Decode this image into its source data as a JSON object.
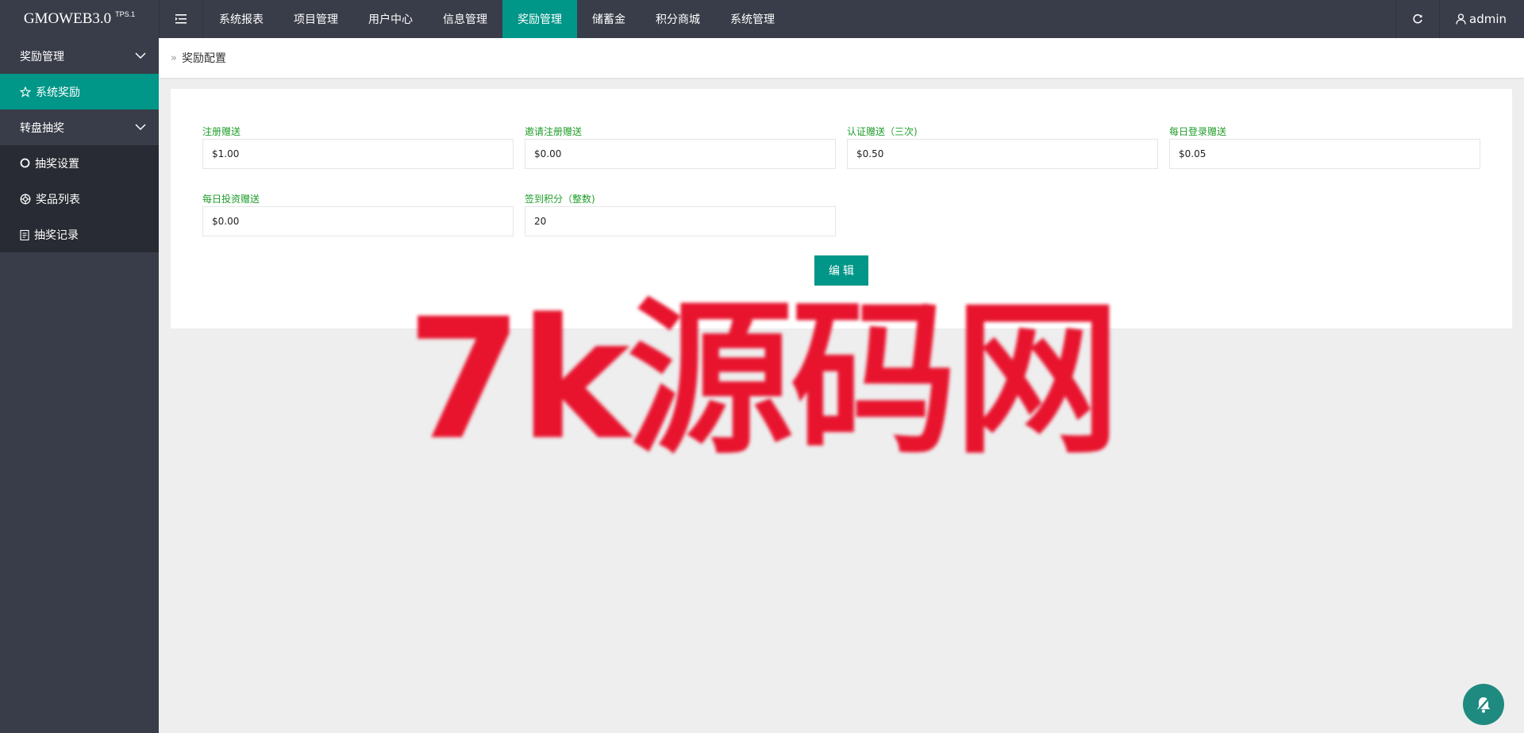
{
  "header": {
    "logo": "GMOWEB3.0",
    "logo_badge": "TPS.1",
    "nav": [
      "系统报表",
      "项目管理",
      "用户中心",
      "信息管理",
      "奖励管理",
      "储蓄金",
      "积分商城",
      "系统管理"
    ],
    "active_nav": "奖励管理",
    "user": "admin"
  },
  "sidebar": {
    "group1": "奖励管理",
    "group1_item": "系统奖励",
    "group2": "转盘抽奖",
    "group2_items": [
      "抽奖设置",
      "奖品列表",
      "抽奖记录"
    ]
  },
  "breadcrumb": {
    "sep": "»",
    "current": "奖励配置"
  },
  "form": {
    "fields": [
      {
        "label": "注册赠送",
        "value": "$1.00"
      },
      {
        "label": "邀请注册赠送",
        "value": "$0.00"
      },
      {
        "label": "认证赠送（三次)",
        "value": "$0.50"
      },
      {
        "label": "每日登录赠送",
        "value": "$0.05"
      },
      {
        "label": "每日投资赠送",
        "value": "$0.00"
      },
      {
        "label": "签到积分（整数)",
        "value": "20"
      }
    ],
    "submit_label": "编 辑"
  },
  "watermark": "7k源码网",
  "colors": {
    "accent": "#009688",
    "header_bg": "#393d49",
    "label_green": "#1f9d2a",
    "watermark": "#e8142e"
  }
}
